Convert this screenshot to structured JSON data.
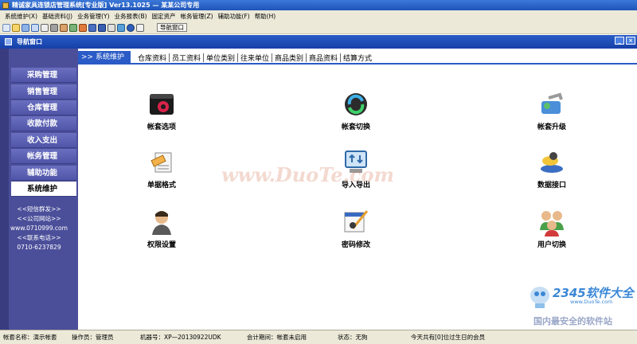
{
  "window": {
    "title": "精诚家具连锁店管理系统[专业版] Ver13.1025 — 某某公司专用"
  },
  "menu": [
    "系统维护(X)",
    "基础资料(J)",
    "业务管理(Y)",
    "业务报表(B)",
    "固定资产",
    "帐务管理(Z)",
    "辅助功能(F)",
    "帮助(H)"
  ],
  "toolbar": {
    "nav_button": "导航窗口",
    "icons": [
      "new-doc-icon",
      "open-icon",
      "list-icon",
      "table-icon",
      "form-icon",
      "tools-icon",
      "user-icon",
      "settings-icon",
      "chart-icon",
      "window-icon",
      "save-icon",
      "print-icon",
      "export-icon",
      "help-icon",
      "info-icon"
    ]
  },
  "nav_window": {
    "title": "导航窗口"
  },
  "sidebar": {
    "items": [
      "采购管理",
      "销售管理",
      "仓库管理",
      "收款付款",
      "收入支出",
      "帐务管理",
      "辅助功能",
      "系统维护"
    ],
    "active": "系统维护",
    "info": [
      "<<短信群发>>",
      "<<公司网站>>",
      "www.0710999.com",
      "<<联系电话>>",
      "0710-6237829"
    ]
  },
  "tabs": {
    "current": ">> 系统维护",
    "items": [
      "仓库资料",
      "员工资料",
      "单位类别",
      "往来单位",
      "商品类别",
      "商品资料",
      "结算方式"
    ]
  },
  "functions": [
    "帐套选项",
    "帐套切换",
    "帐套升级",
    "单据格式",
    "导入导出",
    "数据接口",
    "权限设置",
    "密码修改",
    "用户切换"
  ],
  "watermark": "www.DuoTe.com",
  "logo": {
    "number": "2345软件大全",
    "sub": "www.DuoTe.com",
    "slogan": "国内最安全的软件站"
  },
  "status": {
    "account": "帐套名称：演示帐套",
    "operator": "操作员：管理员",
    "machine": "机器号：XP—20130922UDK",
    "period": "会计期间：帐套未启用",
    "state": "状态：无狗",
    "birthday": "今天共有[0]位过生日的会员"
  }
}
